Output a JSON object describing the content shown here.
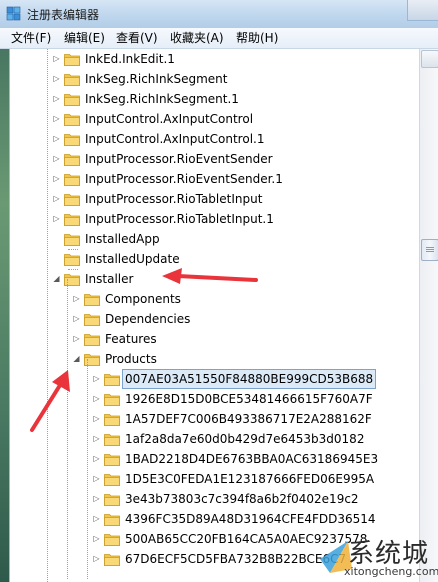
{
  "window": {
    "title": "注册表编辑器"
  },
  "menu": [
    {
      "label": "文件(F)"
    },
    {
      "label": "编辑(E)"
    },
    {
      "label": "查看(V)"
    },
    {
      "label": "收藏夹(A)"
    },
    {
      "label": "帮助(H)"
    }
  ],
  "tree": {
    "level1": [
      {
        "label": "InkEd.InkEdit.1",
        "expander": "collapsed"
      },
      {
        "label": "InkSeg.RichInkSegment",
        "expander": "collapsed"
      },
      {
        "label": "InkSeg.RichInkSegment.1",
        "expander": "collapsed"
      },
      {
        "label": "InputControl.AxInputControl",
        "expander": "collapsed"
      },
      {
        "label": "InputControl.AxInputControl.1",
        "expander": "collapsed"
      },
      {
        "label": "InputProcessor.RioEventSender",
        "expander": "collapsed"
      },
      {
        "label": "InputProcessor.RioEventSender.1",
        "expander": "collapsed"
      },
      {
        "label": "InputProcessor.RioTabletInput",
        "expander": "collapsed"
      },
      {
        "label": "InputProcessor.RioTabletInput.1",
        "expander": "collapsed"
      },
      {
        "label": "InstalledApp",
        "expander": "none"
      },
      {
        "label": "InstalledUpdate",
        "expander": "none"
      },
      {
        "label": "Installer",
        "expander": "expanded"
      }
    ],
    "installer_children": [
      {
        "label": "Components",
        "expander": "collapsed"
      },
      {
        "label": "Dependencies",
        "expander": "collapsed"
      },
      {
        "label": "Features",
        "expander": "collapsed"
      },
      {
        "label": "Products",
        "expander": "expanded"
      }
    ],
    "products_children": [
      {
        "label": "007AE03A51550F84880BE999CD53B688",
        "selected": true
      },
      {
        "label": "1926E8D15D0BCE53481466615F760A7F"
      },
      {
        "label": "1A57DEF7C006B493386717E2A288162F"
      },
      {
        "label": "1af2a8da7e60d0b429d7e6453b3d0182"
      },
      {
        "label": "1BAD2218D4DE6763BBA0AC63186945E3"
      },
      {
        "label": "1D5E3C0FEDA1E123187666FED06E995A"
      },
      {
        "label": "3e43b73803c7c394f8a6b2f0402e19c2"
      },
      {
        "label": "4396FC35D89A48D31964CFE4FDD36514"
      },
      {
        "label": "500AB65CC20FB164CA5A0AEC9237578"
      },
      {
        "label": "67D6ECF5CD5FBA732B8B22BCE6C7"
      }
    ]
  },
  "watermark": {
    "brand": "系统城",
    "url": "xitongcheng.com"
  },
  "colors": {
    "folder": "#f2c64a",
    "arrow": "#e8343a",
    "selection": "#dceaf8"
  }
}
